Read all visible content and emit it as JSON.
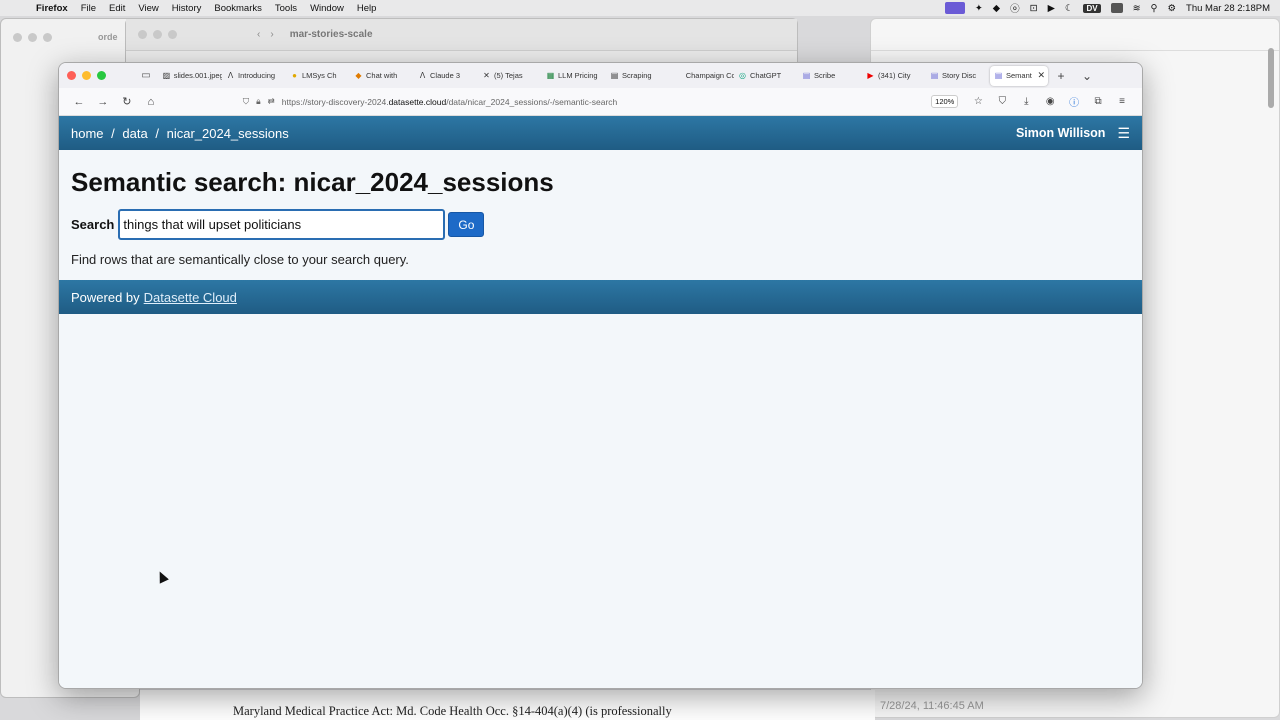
{
  "menubar": {
    "app": "Firefox",
    "items": [
      "File",
      "Edit",
      "View",
      "History",
      "Bookmarks",
      "Tools",
      "Window",
      "Help"
    ],
    "dv_badge": "DV",
    "clock": "Thu Mar 28  2:18PM"
  },
  "background": {
    "finder_title": "mar-stories-scale",
    "left_window_title": "orde",
    "doc_text": "Maryland  Medical  Practice  Act:  Md.  Code  Health  Occ.  §14-404(a)(4)  (is  professionally",
    "doc_stamp": "7/28/24, 11:46:45 AM"
  },
  "browser": {
    "tabs": [
      {
        "label": "slides.001.jpeg",
        "icon": "image-icon"
      },
      {
        "label": "Introducing",
        "icon": "anthropic-icon"
      },
      {
        "label": "LMSys Ch",
        "icon": "lmsys-icon"
      },
      {
        "label": "Chat with",
        "icon": "chat-icon"
      },
      {
        "label": "Claude 3",
        "icon": "anthropic-icon"
      },
      {
        "label": "(5) Tejas",
        "icon": "x-icon"
      },
      {
        "label": "LLM Pricing",
        "icon": "sheet-icon"
      },
      {
        "label": "Scraping",
        "icon": "doc-icon"
      },
      {
        "label": "Champaign Co",
        "icon": "page-icon"
      },
      {
        "label": "ChatGPT",
        "icon": "chatgpt-icon"
      },
      {
        "label": "Scribe",
        "icon": "scribe-icon"
      },
      {
        "label": "(341) City",
        "icon": "youtube-icon"
      },
      {
        "label": "Story Disc",
        "icon": "datasette-icon"
      }
    ],
    "active_tab": {
      "label": "Semant",
      "icon": "datasette-icon"
    },
    "url": {
      "prefix": "https://story-discovery-2024.",
      "host": "datasette.cloud",
      "path": "/data/nicar_2024_sessions/-/semantic-search"
    },
    "zoom": "120%"
  },
  "page": {
    "breadcrumb": {
      "home": "home",
      "sep1": "/",
      "data": "data",
      "sep2": "/",
      "table": "nicar_2024_sessions"
    },
    "user": "Simon Willison",
    "title": "Semantic search: nicar_2024_sessions",
    "search_label": "Search",
    "search_value": "things that will upset politicians",
    "go_label": "Go",
    "hint": "Find rows that are semantically close to your search query.",
    "footer_prefix": "Powered by",
    "footer_link": "Datasette Cloud"
  }
}
